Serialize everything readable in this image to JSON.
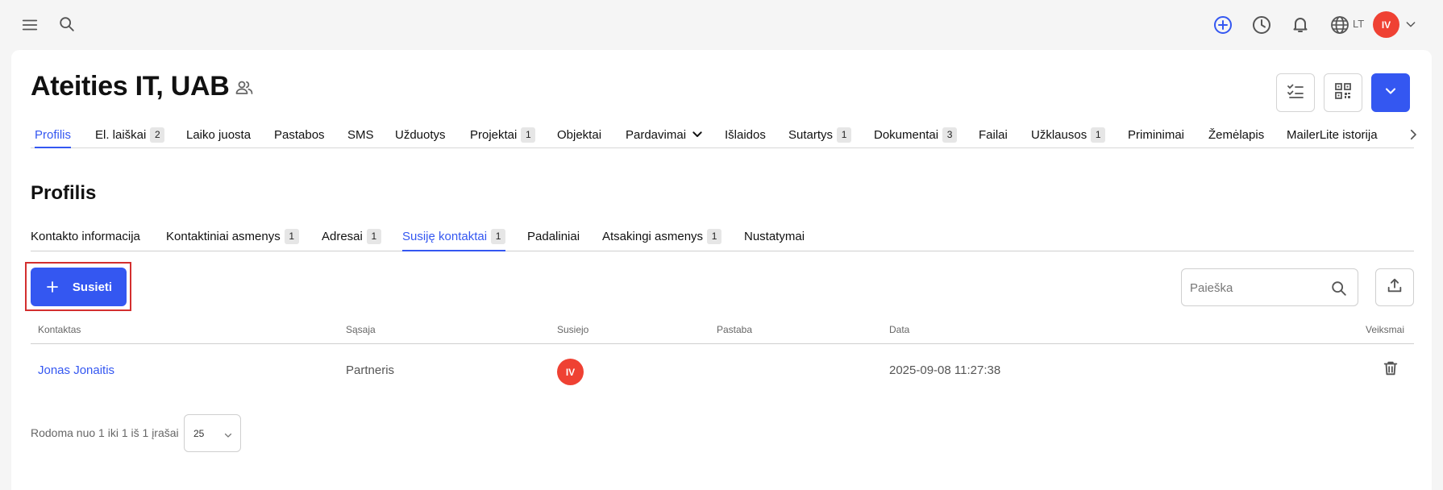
{
  "topbar": {
    "icons": [
      "menu-icon",
      "search-icon",
      "add-circle-icon",
      "clock-icon",
      "bell-icon",
      "globe-icon",
      "chevron-down-icon"
    ],
    "language": "LT",
    "user_initials": "IV",
    "accent_color": "#3457f1",
    "avatar_color": "#ef4133"
  },
  "header": {
    "title": "Ateities IT, UAB",
    "title_icon": "users-icon",
    "action_icons": [
      "checklist-icon",
      "qr-code-icon",
      "chevron-down-icon"
    ]
  },
  "main_tabs": [
    {
      "label": "Profilis",
      "active": true
    },
    {
      "label": "El. laiškai",
      "badge": "2"
    },
    {
      "label": "Laiko juosta"
    },
    {
      "label": "Pastabos"
    },
    {
      "label": "SMS"
    },
    {
      "label": "Užduotys"
    },
    {
      "label": "Projektai",
      "badge": "1"
    },
    {
      "label": "Objektai"
    },
    {
      "label": "Pardavimai",
      "icon": "chevron-down-icon"
    },
    {
      "label": "Išlaidos"
    },
    {
      "label": "Sutartys",
      "badge": "1"
    },
    {
      "label": "Dokumentai",
      "badge": "3"
    },
    {
      "label": "Failai"
    },
    {
      "label": "Užklausos",
      "badge": "1"
    },
    {
      "label": "Priminimai"
    },
    {
      "label": "Žemėlapis"
    },
    {
      "label": "MailerLite istorija"
    }
  ],
  "section": {
    "title": "Profilis"
  },
  "sub_tabs": [
    {
      "label": "Kontakto informacija"
    },
    {
      "label": "Kontaktiniai asmenys",
      "badge": "1"
    },
    {
      "label": "Adresai",
      "badge": "1"
    },
    {
      "label": "Susiję kontaktai",
      "badge": "1",
      "active": true
    },
    {
      "label": "Padaliniai"
    },
    {
      "label": "Atsakingi asmenys",
      "badge": "1"
    },
    {
      "label": "Nustatymai"
    }
  ],
  "toolbar": {
    "link_button": "Susieti",
    "search_placeholder": "Paieška"
  },
  "table": {
    "columns": [
      "Kontaktas",
      "Sąsaja",
      "Susiejo",
      "Pastaba",
      "Data",
      "Veiksmai"
    ],
    "rows": [
      {
        "contact": "Jonas Jonaitis",
        "relation": "Partneris",
        "linked_by": "IV",
        "note": "",
        "date": "2025-09-08 11:27:38"
      }
    ]
  },
  "pager": {
    "text": "Rodoma nuo 1 iki 1 iš 1 įrašai",
    "page_size": "25"
  }
}
